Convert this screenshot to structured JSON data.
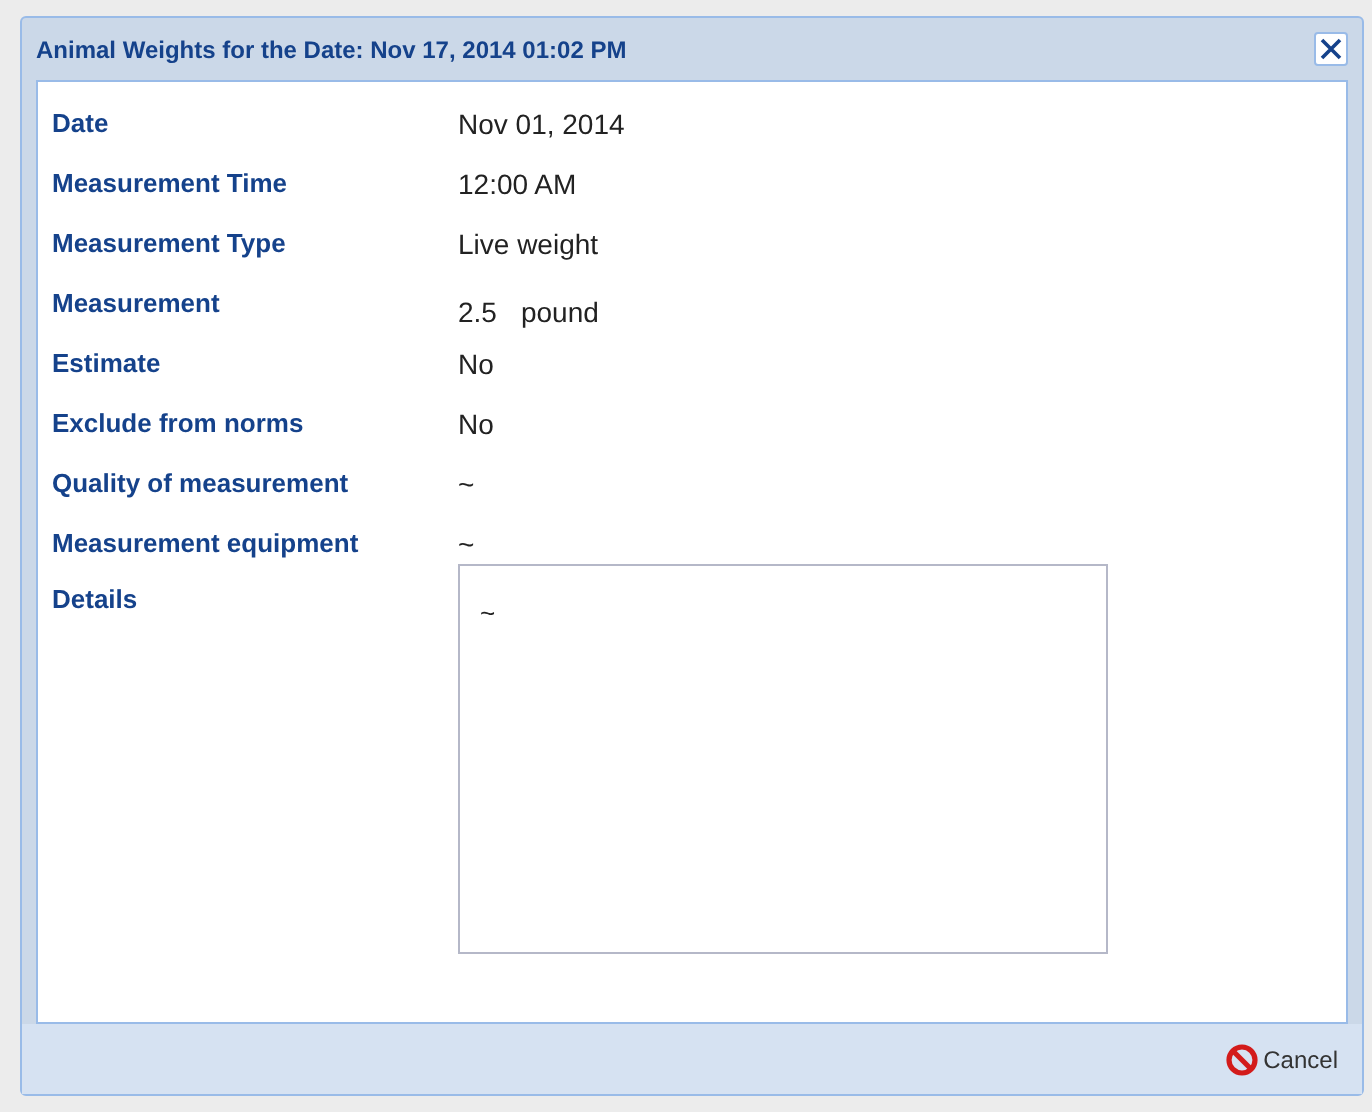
{
  "window": {
    "title": "Animal Weights for the Date: Nov 17, 2014 01:02 PM"
  },
  "fields": [
    {
      "kind": "text",
      "label": "Date",
      "value": "Nov 01, 2014"
    },
    {
      "kind": "text",
      "label": "Measurement Time",
      "value": "12:00 AM"
    },
    {
      "kind": "text",
      "label": "Measurement Type",
      "value": "Live weight"
    },
    {
      "kind": "quantity",
      "label": "Measurement",
      "value": "2.5",
      "unit": "pound"
    },
    {
      "kind": "text",
      "label": "Estimate",
      "value": "No"
    },
    {
      "kind": "text",
      "label": "Exclude from norms",
      "value": "No"
    },
    {
      "kind": "text",
      "label": "Quality of measurement",
      "value": "~"
    },
    {
      "kind": "text",
      "label": "Measurement equipment",
      "value": "~"
    },
    {
      "kind": "textarea",
      "label": "Details",
      "value": "~"
    }
  ],
  "footer": {
    "buttons": [
      "Cancel"
    ]
  }
}
